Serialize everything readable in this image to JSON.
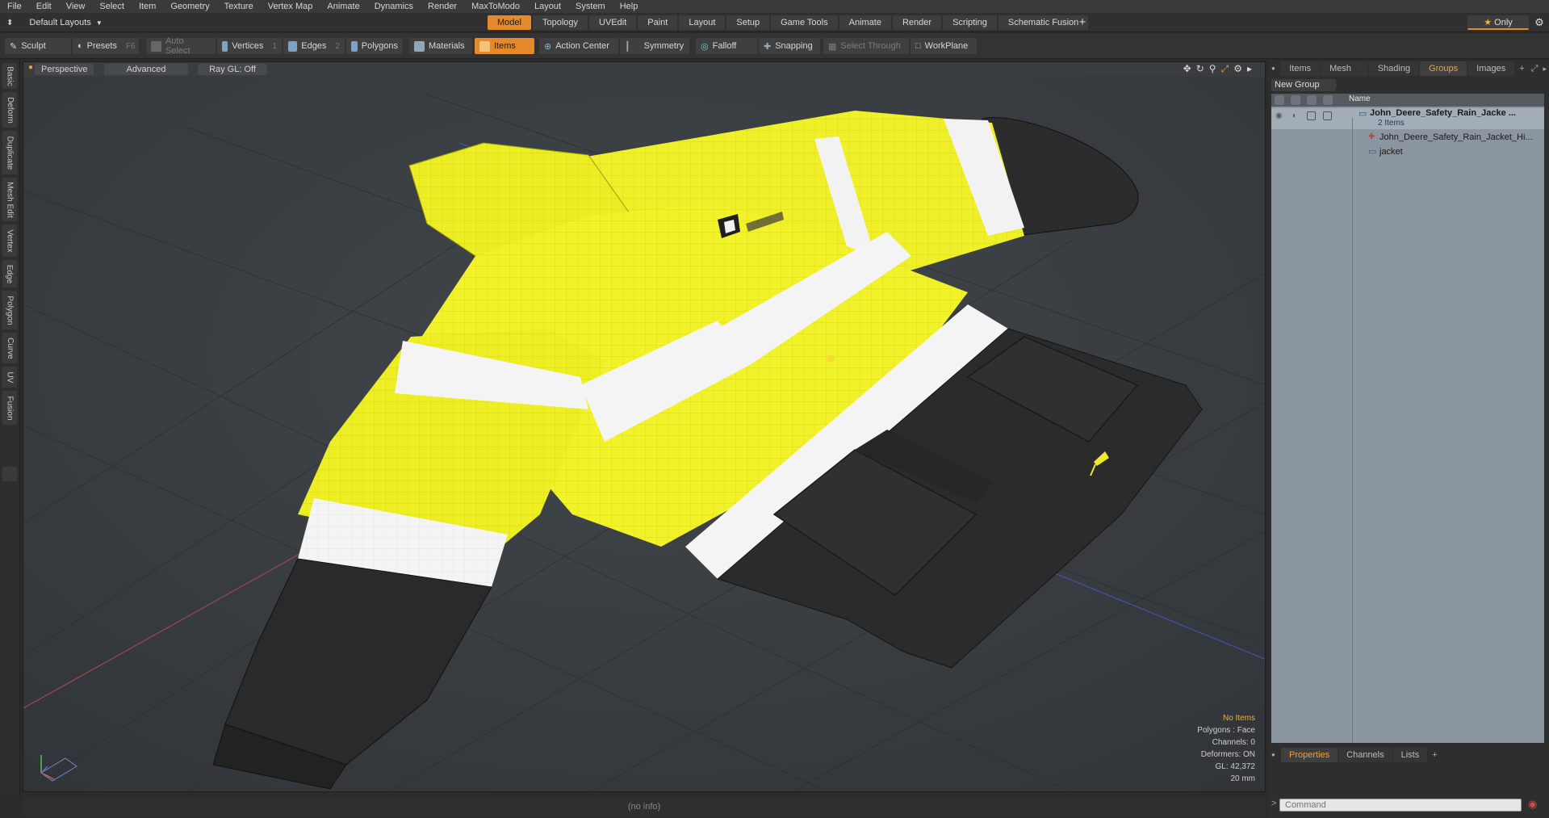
{
  "menu": [
    "File",
    "Edit",
    "View",
    "Select",
    "Item",
    "Geometry",
    "Texture",
    "Vertex Map",
    "Animate",
    "Dynamics",
    "Render",
    "MaxToModo",
    "Layout",
    "System",
    "Help"
  ],
  "layout": {
    "label": "Default Layouts"
  },
  "tabs": [
    "Model",
    "Topology",
    "UVEdit",
    "Paint",
    "Layout",
    "Setup",
    "Game Tools",
    "Animate",
    "Render",
    "Scripting",
    "Schematic Fusion"
  ],
  "active_tab": "Model",
  "only_label": "Only",
  "toolbar": {
    "sculpt": "Sculpt",
    "presets": "Presets",
    "presets_key": "F6",
    "auto_select": "Auto Select",
    "vertices": "Vertices",
    "vertices_key": "1",
    "edges": "Edges",
    "edges_key": "2",
    "polygons": "Polygons",
    "materials": "Materials",
    "items": "Items",
    "action_center": "Action Center",
    "symmetry": "Symmetry",
    "falloff": "Falloff",
    "snapping": "Snapping",
    "select_through": "Select Through",
    "workplane": "WorkPlane"
  },
  "left_tabs": [
    "Basic",
    "Deform",
    "Duplicate",
    "Mesh Edit",
    "Vertex",
    "Edge",
    "Polygon",
    "Curve",
    "UV",
    "Fusion"
  ],
  "viewport": {
    "perspective": "Perspective",
    "advanced": "Advanced",
    "raygl": "Ray GL: Off",
    "stats": {
      "no_items": "No Items",
      "polygons": "Polygons : Face",
      "channels": "Channels: 0",
      "deformers": "Deformers: ON",
      "gl": "GL: 42,372",
      "scale": "20 mm"
    }
  },
  "status": "(no info)",
  "right_panel": {
    "tabs": [
      "Items",
      "Mesh ...",
      "Shading",
      "Groups",
      "Images"
    ],
    "active": "Groups",
    "new_group": "New Group",
    "column_name": "Name",
    "rows": {
      "group_name": "John_Deere_Safety_Rain_Jacke ...",
      "group_count": "2 Items",
      "child1": "John_Deere_Safety_Rain_Jacket_Hi...",
      "child2": "jacket"
    }
  },
  "bottom_tabs": [
    "Properties",
    "Channels",
    "Lists"
  ],
  "bottom_active": "Properties",
  "command_placeholder": "Command",
  "colors": {
    "accent": "#e58a2a",
    "jacket_yellow": "#f2f22a",
    "reflective": "#f2f2f2",
    "dark_fabric": "#2a2a2a"
  }
}
